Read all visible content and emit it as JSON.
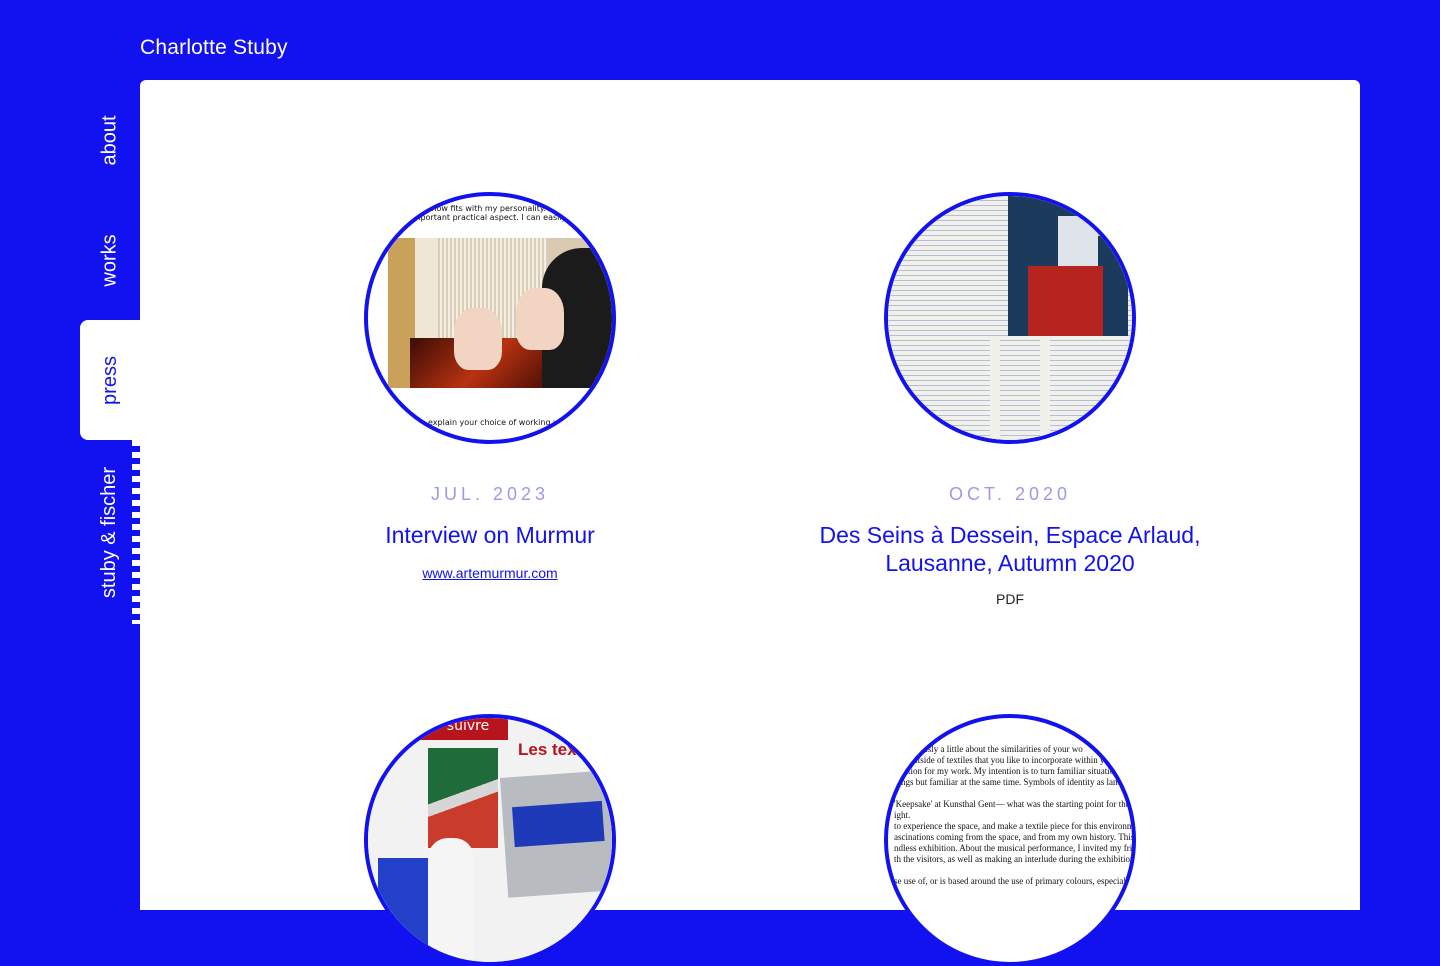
{
  "site": {
    "title": "Charlotte Stuby"
  },
  "nav": {
    "items": [
      {
        "label": "about"
      },
      {
        "label": "works"
      },
      {
        "label": "press"
      },
      {
        "label": "stuby & fischer"
      }
    ],
    "active": "press"
  },
  "colors": {
    "brand": "#1212f0",
    "date": "#9a9ae8",
    "background": "#ffffff"
  },
  "press": [
    {
      "date": "JUL. 2023",
      "title": "Interview on Murmur",
      "link": "www.artemurmur.com",
      "thumb_text_top": [
        "es somehow fits with my personality.",
        "an important practical aspect. I can easily fold"
      ],
      "thumb_text_bottom": "explain your choice of working wi"
    },
    {
      "date": "OCT. 2020",
      "title": "Des Seins à Dessein, Espace Arlaud, Lausanne, Autumn 2020",
      "link_label": "PDF"
    },
    {
      "thumb_text": [
        "suivre",
        "Les tex"
      ]
    },
    {
      "thumb_lines": [
        "e previously a little about the similarities of your wo",
        "ons outside of textiles that you like to incorporate within yo",
        "piration for my work. My intention is to turn familiar situatio",
        "dings but familiar at the same time. Symbols of identity as landm",
        "",
        "'Keepsake' at Kunsthal Gent— what was the starting point for the installa",
        "ight.",
        "to experience the space, and make a textile piece for this environment. Th",
        "ascinations coming from the space, and from my own history. This piece",
        "ndless exhibition. About the musical performance, I invited my friend E",
        "th the visitors, as well as making an interlude during the exhibition's o",
        "",
        "se use of, or is based around the use of primary colours, especially blu"
      ]
    }
  ]
}
